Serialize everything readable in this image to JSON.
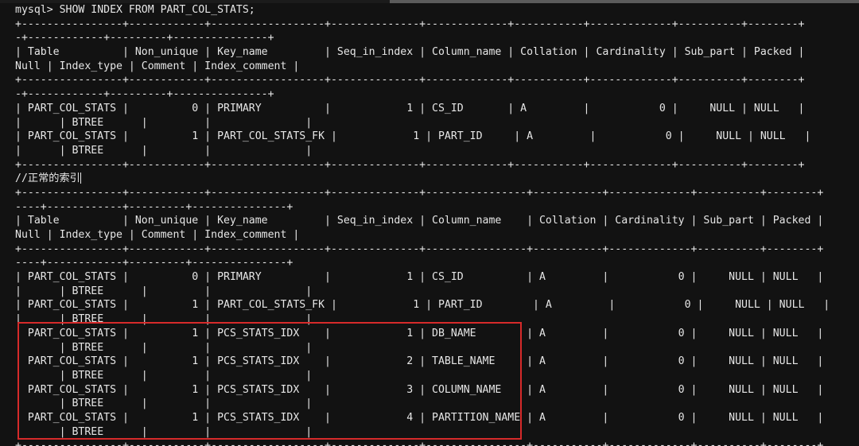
{
  "terminal": {
    "lines": [
      "mysql> SHOW INDEX FROM PART_COL_STATS;",
      "+----------------+------------+------------------+--------------+-------------+-----------+-------------+----------+--------+",
      "-+------------+---------+---------------+",
      "| Table          | Non_unique | Key_name         | Seq_in_index | Column_name | Collation | Cardinality | Sub_part | Packed |",
      "Null | Index_type | Comment | Index_comment |",
      "+----------------+------------+------------------+--------------+-------------+-----------+-------------+----------+--------+",
      "-+------------+---------+---------------+",
      "| PART_COL_STATS |          0 | PRIMARY          |            1 | CS_ID       | A         |           0 |     NULL | NULL   |",
      "|      | BTREE      |         |               |",
      "| PART_COL_STATS |          1 | PART_COL_STATS_FK |            1 | PART_ID     | A         |           0 |     NULL | NULL   |",
      "|      | BTREE      |         |               |",
      "+----------------+------------+------------------+--------------+-------------+-----------+-------------+----------+--------+",
      "//正常的索引",
      "+----------------+------------+------------------+--------------+----------------+-----------+-------------+----------+--------+",
      "----+------------+---------+---------------+",
      "| Table          | Non_unique | Key_name         | Seq_in_index | Column_name    | Collation | Cardinality | Sub_part | Packed |",
      "Null | Index_type | Comment | Index_comment |",
      "+----------------+------------+------------------+--------------+----------------+-----------+-------------+----------+--------+",
      "----+------------+---------+---------------+",
      "| PART_COL_STATS |          0 | PRIMARY          |            1 | CS_ID          | A         |           0 |     NULL | NULL   |",
      "|      | BTREE      |         |               |",
      "| PART_COL_STATS |          1 | PART_COL_STATS_FK |            1 | PART_ID        | A         |           0 |     NULL | NULL   |",
      "|      | BTREE      |         |               |",
      "| PART_COL_STATS |          1 | PCS_STATS_IDX    |            1 | DB_NAME        | A         |           0 |     NULL | NULL   |",
      "|      | BTREE      |         |               |",
      "| PART_COL_STATS |          1 | PCS_STATS_IDX    |            2 | TABLE_NAME     | A         |           0 |     NULL | NULL   |",
      "|      | BTREE      |         |               |",
      "| PART_COL_STATS |          1 | PCS_STATS_IDX    |            3 | COLUMN_NAME    | A         |           0 |     NULL | NULL   |",
      "|      | BTREE      |         |               |",
      "| PART_COL_STATS |          1 | PCS_STATS_IDX    |            4 | PARTITION_NAME | A         |           0 |     NULL | NULL   |",
      "|      | BTREE      |         |               |",
      "+----------------+------------+------------------+--------------+----------------+-----------+-------------+----------+--------+"
    ]
  },
  "colors": {
    "background": "#121212",
    "text": "#e6e6e6",
    "highlight": "#d62a2a"
  }
}
